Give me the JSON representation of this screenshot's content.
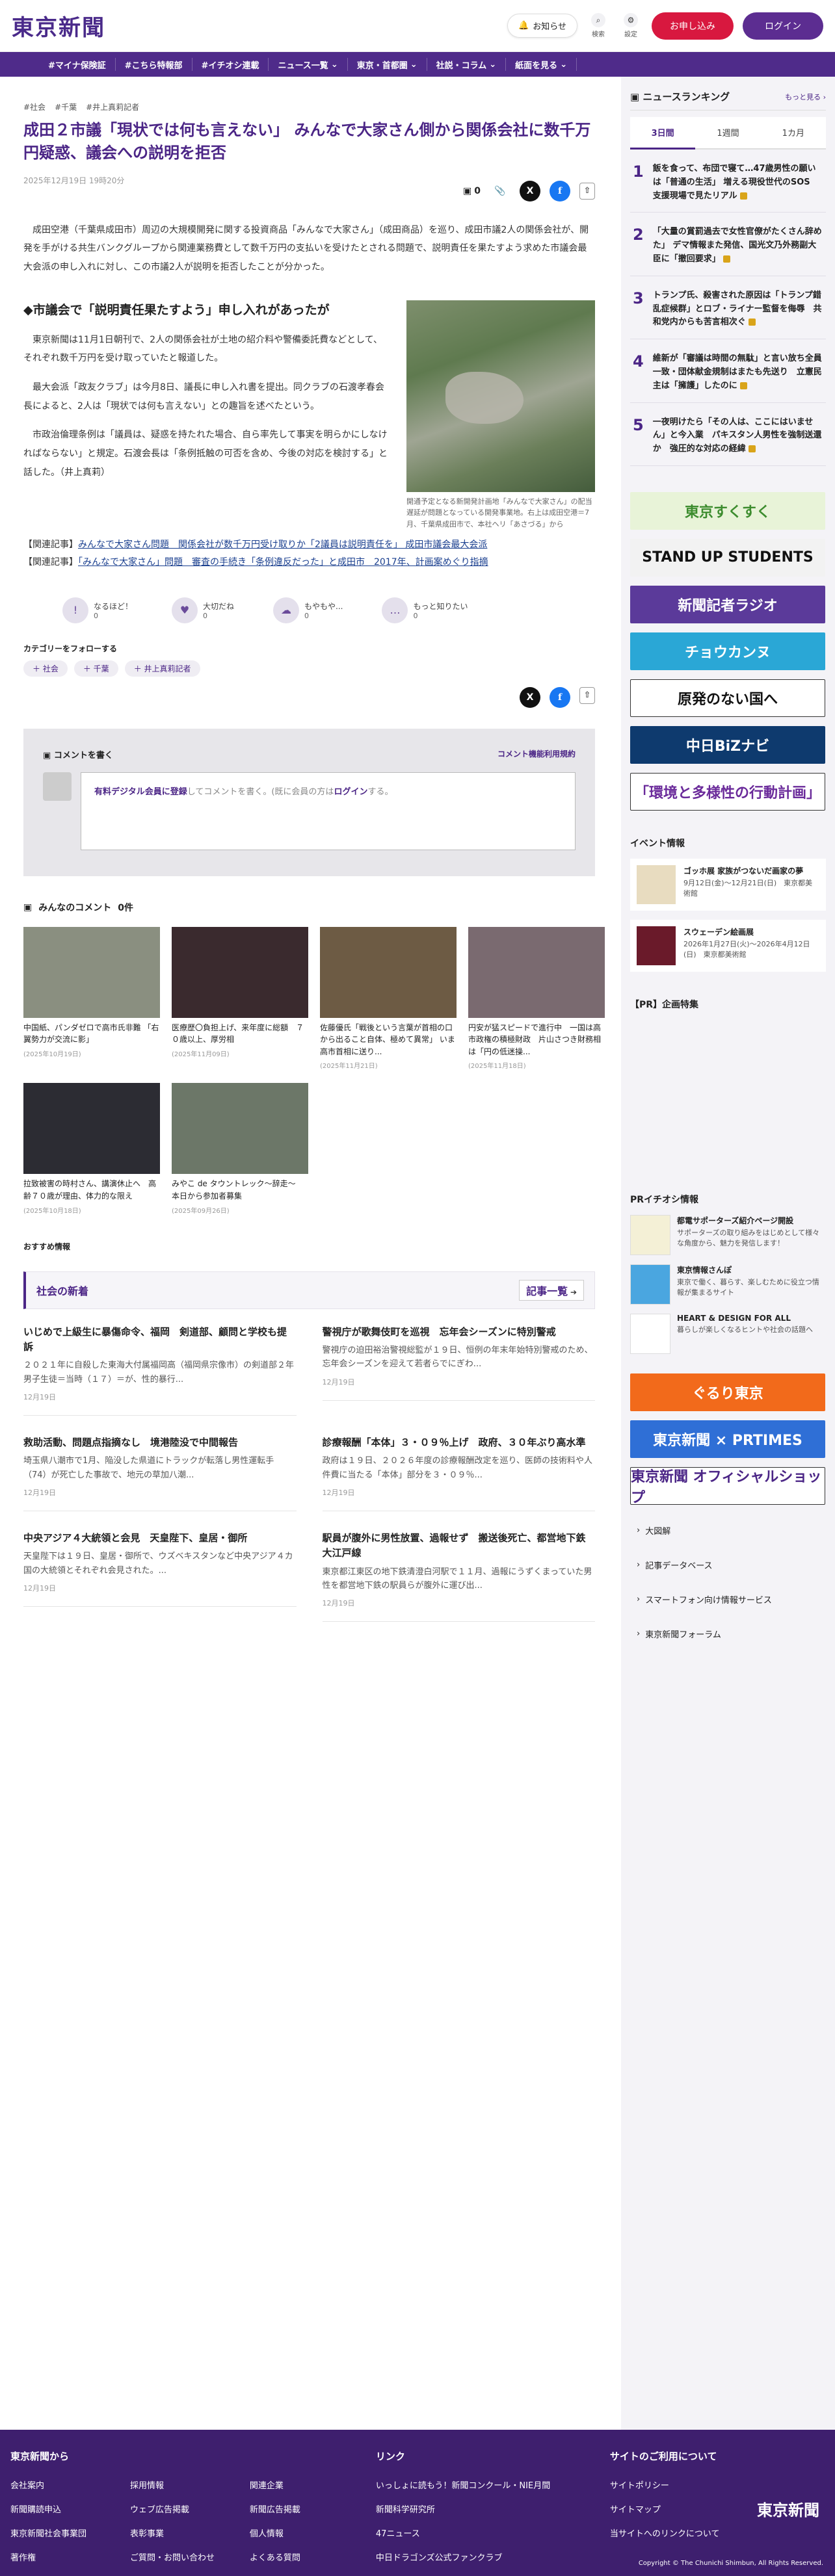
{
  "header": {
    "logo": "東京新聞",
    "notice": "お知らせ",
    "search": "検索",
    "settings": "設定",
    "subscribe": "お申し込み",
    "login": "ログイン"
  },
  "nav": [
    "#マイナ保険証",
    "#こちら特報部",
    "#イチオシ連載",
    "ニュース一覧",
    "東京・首都圏",
    "社説・コラム",
    "紙面を見る"
  ],
  "article": {
    "tags": [
      "#社会",
      "#千葉",
      "#井上真莉記者"
    ],
    "title": "成田２市議「現状では何も言えない」 みんなで大家さん側から関係会社に数千万円疑惑、議会への説明を拒否",
    "date": "2025年12月19日 19時20分",
    "comment_count": "0",
    "lead": "成田空港（千葉県成田市）周辺の大規模開発に関する投資商品「みんなで大家さん」（成田商品）を巡り、成田市議2人の関係会社が、開発を手がける共生バンクグループから関連業務費として数千万円の支払いを受けたとされる問題で、説明責任を果たすよう求めた市議会最大会派の申し入れに対し、この市議2人が説明を拒否したことが分かった。",
    "subheading": "◆市議会で「説明責任果たすよう」申し入れがあったが",
    "paras": [
      "東京新聞は11月1日朝刊で、2人の関係会社が土地の紹介料や警備委託費などとして、それぞれ数千万円を受け取っていたと報道した。",
      "最大会派「政友クラブ」は今月8日、議長に申し入れ書を提出。同クラブの石渡孝春会長によると、2人は「現状では何も言えない」との趣旨を述べたという。",
      "市政治倫理条例は「議員は、疑惑を持たれた場合、自ら率先して事実を明らかにしなければならない」と規定。石渡会長は「条例抵触の可否を含め、今後の対応を検討する」と話した。（井上真莉）"
    ],
    "photo_caption": "開通予定となる新開発計画地「みんなで大家さん」の配当遅延が問題となっている開発事業地。右上は成田空港＝7月、千葉県成田市で、本社ヘリ「あさづる」から",
    "related": [
      {
        "prefix": "【関連記事】",
        "text": "みんなで大家さん問題　関係会社が数千万円受け取りか「2議員は説明責任を」 成田市議会最大会派"
      },
      {
        "prefix": "【関連記事】",
        "text": "「みんなで大家さん」問題　審査の手続き「条例違反だった」と成田市　2017年、計画案めぐり指摘"
      }
    ]
  },
  "reactions": [
    {
      "label": "なるほど！",
      "count": "0"
    },
    {
      "label": "大切だね",
      "count": "0"
    },
    {
      "label": "もやもや...",
      "count": "0"
    },
    {
      "label": "もっと知りたい",
      "count": "0"
    }
  ],
  "follow": {
    "heading": "カテゴリーをフォローする",
    "chips": [
      "社会",
      "千葉",
      "井上真莉記者"
    ]
  },
  "comment_box": {
    "heading": "コメントを書く",
    "rules_link": "コメント機能利用規約",
    "placeholder_pre": "有料デジタル会員に登録",
    "placeholder_mid": "してコメントを書く。(既に会員の方は",
    "placeholder_login": "ログイン",
    "placeholder_post": "する。"
  },
  "comments_section": {
    "heading": "みんなのコメント",
    "count": "0件"
  },
  "cards": [
    {
      "title": "中国紙、パンダゼロで高市氏非難 「右翼勢力が交流に影」",
      "date": "(2025年10月19日)",
      "color": "#8a8f80"
    },
    {
      "title": "医療歴〇負担上げ、来年度に総額　７０歳以上、厚労相",
      "date": "(2025年11月09日)",
      "color": "#3a2a2e"
    },
    {
      "title": "佐藤優氏「戦後という言葉が首相の口から出ること自体、極めて異常」 いま高市首相に送り...",
      "date": "(2025年11月21日)",
      "color": "#6d5b44"
    },
    {
      "title": "円安が猛スピードで進行中　一国は高市政権の積極財政　片山さつき財務相は「円の低迷操...",
      "date": "(2025年11月18日)",
      "color": "#7a6a70"
    },
    {
      "title": "拉致被害の時村さん、講演休止へ　高齢７０歳が理由、体力的な限え",
      "date": "(2025年10月18日)",
      "color": "#2c2c33"
    },
    {
      "title": "みやこ de タウントレック〜辞走〜　本日から参加者募集",
      "date": "(2025年09月26日)",
      "color": "#6c7768"
    }
  ],
  "reco_label": "おすすめ情報",
  "latest": {
    "heading": "社会の新着",
    "more": "記事一覧",
    "items": [
      {
        "title": "いじめで上級生に暴傷命令、福岡　剣道部、顧問と学校も提訴",
        "body": "２０２１年に自殺した東海大付属福岡高（福岡県宗像市）の剣道部２年男子生徒＝当時（１７）＝が、性的暴行...",
        "date": "12月19日"
      },
      {
        "title": "警視庁が歌舞伎町を巡視　忘年会シーズンに特別警戒",
        "body": "警視庁の迫田裕治警視総監が１９日、恒例の年末年始特別警戒のため、忘年会シーズンを迎えて若者らでにぎわ...",
        "date": "12月19日"
      },
      {
        "title": "救助活動、問題点指摘なし　境港陸没で中間報告",
        "body": "埼玉県八潮市で1月、陥没した県道にトラックが転落し男性運転手（74）が死亡した事故で、地元の草加八潮...",
        "date": "12月19日"
      },
      {
        "title": "診療報酬「本体」３・０９％上げ　政府、３０年ぶり高水準",
        "body": "政府は１９日、２０２６年度の診療報酬改定を巡り、医師の技術料や人件費に当たる「本体」部分を３・０９％...",
        "date": "12月19日"
      },
      {
        "title": "中央アジア４大統領と会見　天皇陛下、皇居・御所",
        "body": "天皇陛下は１９日、皇居・御所で、ウズベキスタンなど中央アジア４カ国の大統領とそれぞれ会見された。...",
        "date": "12月19日"
      },
      {
        "title": "駅員が腹外に男性放置、過報せず　搬送後死亡、都営地下鉄大江戸線",
        "body": "東京都江東区の地下鉄清澄白河駅で１１月、過報にうずくまっていた男性を都営地下鉄の駅員らが腹外に運び出...",
        "date": "12月19日"
      }
    ]
  },
  "ranking": {
    "heading": "ニュースランキング",
    "more": "もっと見る",
    "tabs": [
      "3日間",
      "1週間",
      "1カ月"
    ],
    "items": [
      {
        "n": "1",
        "title": "飯を食って、布団で寝て…47歳男性の願いは「普通の生活」 増える現役世代のSOS　支援現場で見たリアル"
      },
      {
        "n": "2",
        "title": "「大量の賞罰過去で女性官僚がたくさん辞めた」 デマ情報また発信、国光文乃外務副大臣に「撤回要求」"
      },
      {
        "n": "3",
        "title": "トランプ氏、殺害された原因は「トランプ錯乱症候群」とロブ・ライナー監督を侮辱　共和党内からも苦言相次ぐ"
      },
      {
        "n": "4",
        "title": "維新が「審議は時間の無駄」と言い放ち全員一致・団体献金規制はまたも先送り　立憲民主は「擁護」したのに"
      },
      {
        "n": "5",
        "title": "一夜明けたら「その人は、ここにはいません」と今入業　パキスタン人男性を強制送還か　強圧的な対応の経緯"
      }
    ]
  },
  "banners": [
    {
      "text": "東京すくすく",
      "bg": "#e8f3d8",
      "fg": "#3c8c2e"
    },
    {
      "text": "STAND UP STUDENTS",
      "bg": "#f2f2f2",
      "fg": "#111"
    },
    {
      "text": "新聞記者ラジオ",
      "bg": "#5b3a9a",
      "fg": "#fff"
    },
    {
      "text": "チョウカンヌ",
      "bg": "#2aa7d6",
      "fg": "#fff"
    },
    {
      "text": "原発のない国へ",
      "bg": "#fff",
      "fg": "#111"
    },
    {
      "text": "中日BiZナビ",
      "bg": "#0e3a6e",
      "fg": "#fff"
    },
    {
      "text": "「環境と多様性の行動計画」",
      "bg": "#fff",
      "fg": "#6a2a9a"
    }
  ],
  "events": {
    "heading": "イベント情報",
    "items": [
      {
        "title": "ゴッホ展 家族がつないだ画家の夢",
        "sub": "9月12日(金)〜12月21日(日)　東京都美術館",
        "color": "#e8dcc0"
      },
      {
        "title": "スウェーデン絵画展",
        "sub": "2026年1月27日(火)〜2026年4月12日(日)　東京都美術館",
        "color": "#6a1a2a"
      }
    ]
  },
  "pr_feature": "【PR】企画特集",
  "pr": {
    "heading": "PRイチオシ情報",
    "items": [
      {
        "title": "都電サポーターズ紹介ページ開設",
        "sub": "サポーターズの取り組みをはじめとして様々な角度から、魅力を発信します！",
        "color": "#f4f0d6"
      },
      {
        "title": "東京情報さんぽ",
        "sub": "東京で働く、暮らす、楽しむために役立つ情報が集まるサイト",
        "color": "#4aa6e0"
      },
      {
        "title": "HEART & DESIGN FOR ALL",
        "sub": "暮らしが楽しくなるヒントや社会の話題へ",
        "color": "#ffffff"
      }
    ]
  },
  "banners2": [
    {
      "text": "ぐるり東京",
      "bg": "#f26a1b",
      "fg": "#fff"
    },
    {
      "text": "東京新聞 × PRTIMES",
      "bg": "#2f6fd6",
      "fg": "#fff"
    },
    {
      "text": "東京新聞 オフィシャルショップ",
      "bg": "#fff",
      "fg": "#4b2586"
    }
  ],
  "side_links": [
    "大図解",
    "記事データベース",
    "スマートフォン向け情報サービス",
    "東京新聞フォーラム"
  ],
  "footer": {
    "col1": {
      "heading": "東京新聞から",
      "links": [
        "会社案内",
        "採用情報",
        "関連企業",
        "新聞購読申込",
        "ウェブ広告掲載",
        "新聞広告掲載",
        "東京新聞社会事業団",
        "表彰事業",
        "個人情報",
        "著作権",
        "ご質問・お問い合わせ",
        "よくある質問"
      ]
    },
    "col2": {
      "heading": "リンク",
      "links": [
        "いっしょに読もう！新聞コンクール・NIE月間",
        "新聞科学研究所",
        "47ニュース",
        "中日ドラゴンズ公式ファンクラブ"
      ]
    },
    "col3": {
      "heading": "サイトのご利用について",
      "links": [
        "サイトポリシー",
        "サイトマップ",
        "当サイトへのリンクについて"
      ]
    },
    "logo": "東京新聞",
    "copyright": "Copyright © The Chunichi Shimbun, All Rights Reserved."
  }
}
